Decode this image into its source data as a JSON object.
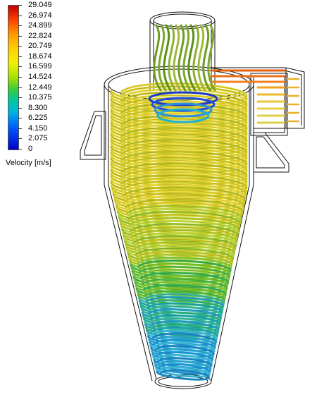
{
  "legend": {
    "ticks": [
      "29.049",
      "26.974",
      "24.899",
      "22.824",
      "20.749",
      "18.674",
      "16.599",
      "14.524",
      "12.449",
      "10.375",
      "8.300",
      "6.225",
      "4.150",
      "2.075",
      "0"
    ],
    "title": "Velocity [m/s]"
  }
}
